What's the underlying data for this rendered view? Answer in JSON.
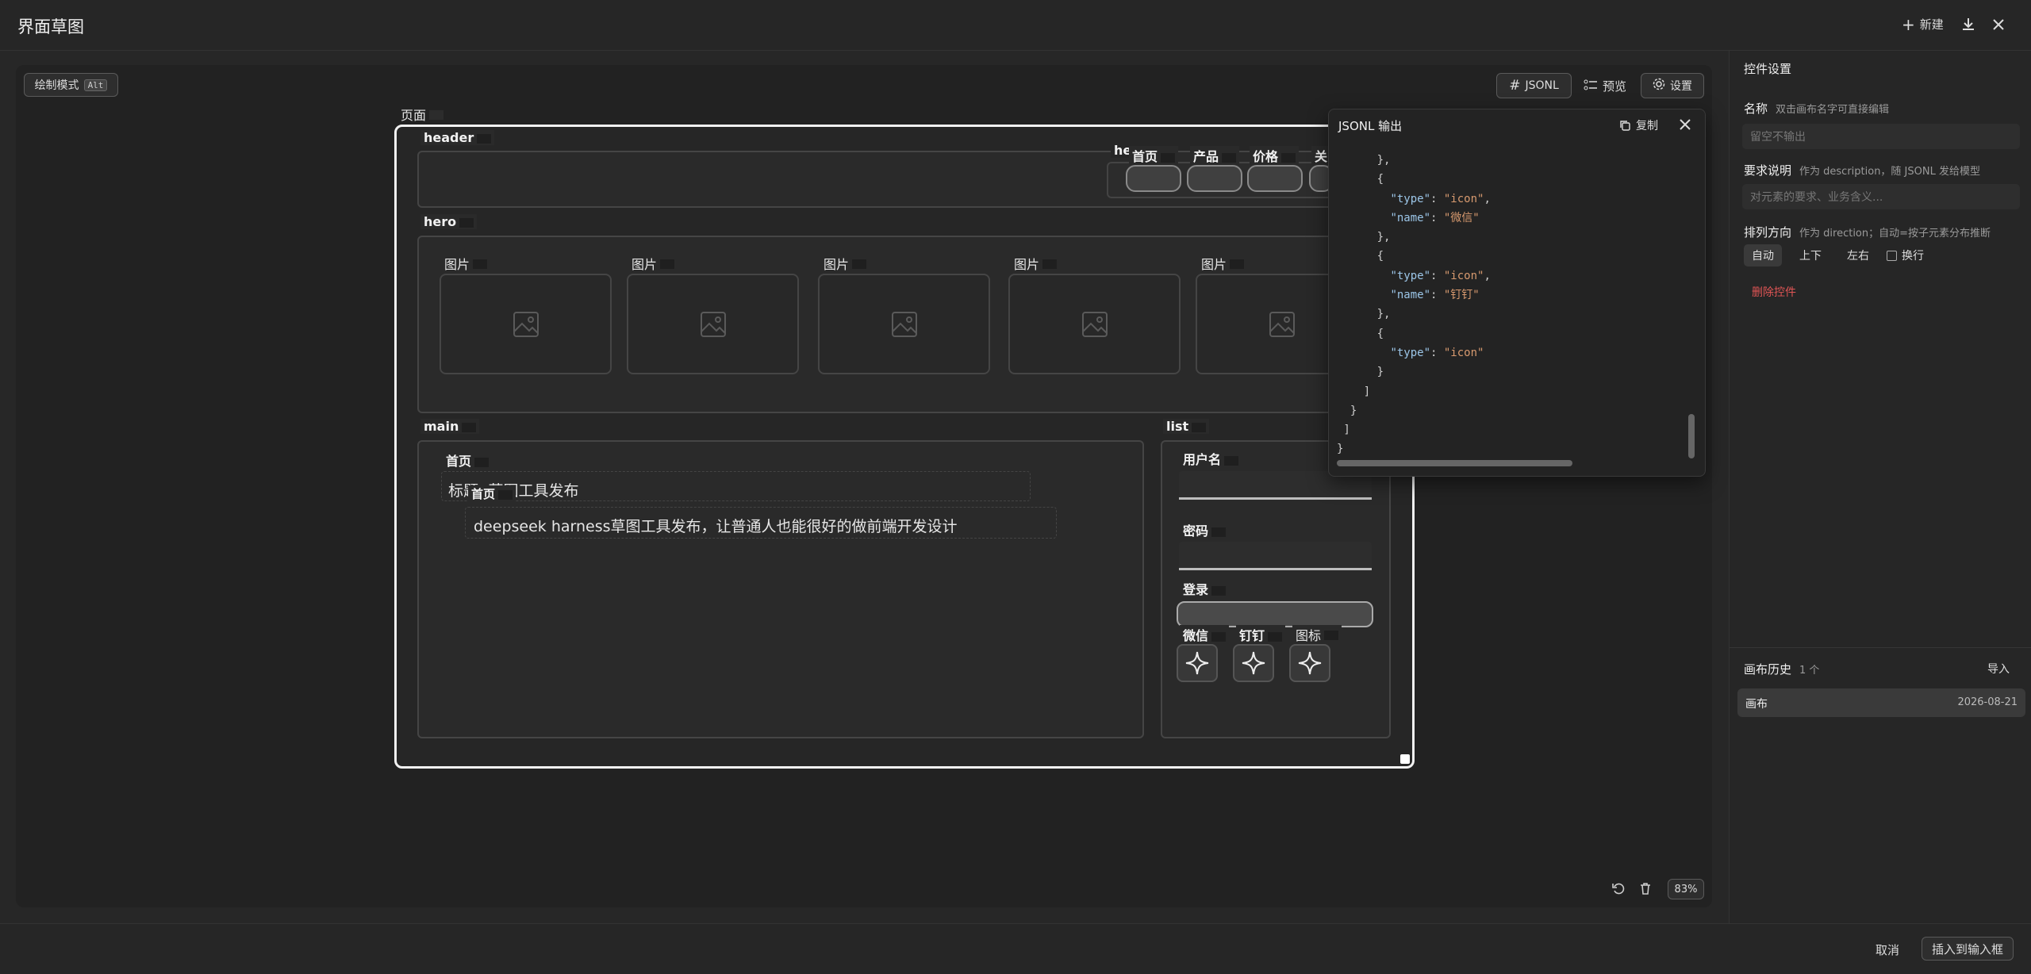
{
  "app": {
    "title": "界面草图",
    "new_label": "新建"
  },
  "toolbar": {
    "draw_mode": "绘制模式",
    "draw_key": "Alt",
    "jsonl": "JSONL",
    "preview": "预览",
    "settings": "设置"
  },
  "sketch": {
    "page": "页面",
    "header": "header",
    "header_nav": {
      "he": "he",
      "items": [
        "首页",
        "产品",
        "价格",
        "关"
      ]
    },
    "hero": "hero",
    "hero_images": [
      "图片",
      "图片",
      "图片",
      "图片",
      "图片"
    ],
    "main": "main",
    "main_label": "首页",
    "main_title": "标题: 草图工具发布",
    "main_sub_label": "首页",
    "main_text": "deepseek harness草图工具发布，让普通人也能很好的做前端开发设计",
    "list": "list",
    "username": "用户名",
    "password": "密码",
    "login": "登录",
    "icons": [
      "微信",
      "钉钉",
      "图标"
    ]
  },
  "json_panel": {
    "title": "JSONL 输出",
    "copy": "复制",
    "lines": [
      "      },",
      "      {",
      "        \"type\": \"icon\",",
      "        \"name\": \"微信\"",
      "      },",
      "      {",
      "        \"type\": \"icon\",",
      "        \"name\": \"钉钉\"",
      "      },",
      "      {",
      "        \"type\": \"icon\"",
      "      }",
      "    ]",
      "  }",
      " ]",
      "}"
    ]
  },
  "canvas_footer": {
    "zoom": "83%"
  },
  "settings_panel": {
    "title": "控件设置",
    "name_label": "名称",
    "name_hint": "双击画布名字可直接编辑",
    "name_placeholder": "留空不输出",
    "req_label": "要求说明",
    "req_hint": "作为 description，随 JSONL 发给模型",
    "req_placeholder": "对元素的要求、业务含义...",
    "dir_label": "排列方向",
    "dir_hint": "作为 direction；自动=按子元素分布推断",
    "dir_options": [
      "自动",
      "上下",
      "左右"
    ],
    "wrap_label": "换行",
    "delete": "删除控件",
    "history_label": "画布历史",
    "history_count": "1 个",
    "import": "导入",
    "history_item": "画布",
    "history_date": "2026-08-21"
  },
  "footer": {
    "cancel": "取消",
    "insert": "插入到输入框"
  },
  "colors": {
    "accent_delete": "#e05555",
    "bg": "#272727"
  }
}
